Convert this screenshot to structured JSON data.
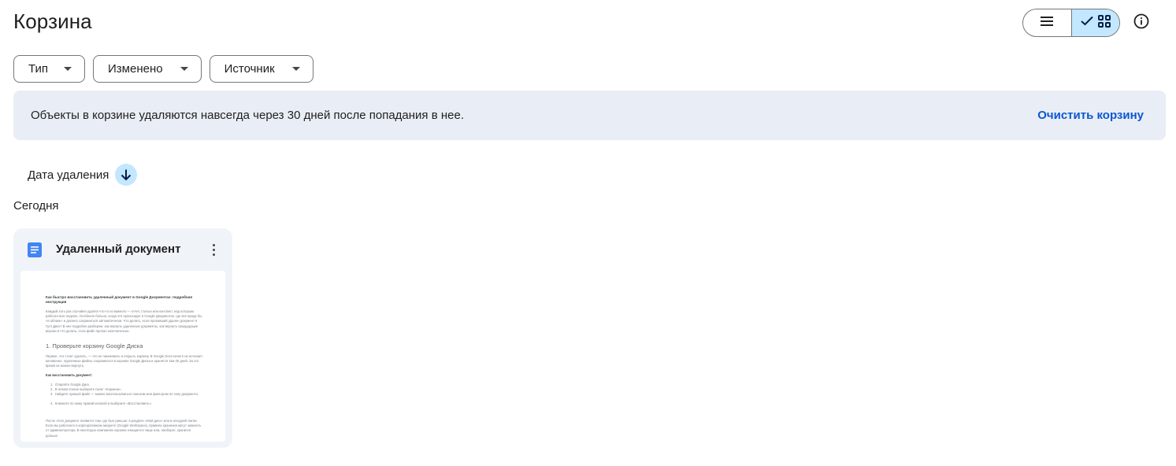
{
  "header": {
    "title": "Корзина",
    "view_toggle": {
      "list_icon": "list-icon",
      "grid_icon": "grid-icon",
      "check_icon": "check-icon",
      "active": "grid"
    },
    "info_icon": "info-icon"
  },
  "filters": [
    {
      "label": "Тип"
    },
    {
      "label": "Изменено"
    },
    {
      "label": "Источник"
    }
  ],
  "banner": {
    "text": "Объекты в корзине удаляются навсегда через 30 дней после попадания в нее.",
    "action": "Очистить корзину"
  },
  "sort": {
    "label": "Дата удаления",
    "direction_icon": "arrow-down-icon"
  },
  "group": {
    "label": "Сегодня"
  },
  "files": [
    {
      "name": "Удаленный документ",
      "type_icon": "google-docs-icon",
      "preview": {
        "title": "Как быстро восстановить удаленный документ в Google Документах: подробная инструкция",
        "intro": "Каждый хоть раз случайно удалял что-то из важного — отчет, статью или конспект, над которым работал всю неделю. Особенно больно, когда это происходит в Google Документах, где все вроде бы «в облаке» и должно сохраниться автоматически. Что делать, если пропавший удален документ в Гугл Диск? В нее подробно разберем, как вернуть удаленные документы, как вернуть предыдущие версии и что делать, если файл пропал окончательно.",
        "heading": "1. Проверьте корзину Google Диска",
        "para2": "Первое, что стоит сделать, — это не паниковать и открыть корзину. В Google Docs ничего не исчезает мгновенно. Удаленные файлы сохраняются в корзине Google Диска и хранятся там 30 дней. За это время их можно вернуть.",
        "subheading": "Как восстановить документ:",
        "steps": [
          "Откройте Google Диск.",
          "В левом списке выберите пункт «Корзина».",
          "Найдите нужный файл — можно воспользоваться поиском или фильтром по типу документа.",
          "Кликните по нему правой кнопкой и выберите «Восстановить»."
        ],
        "para3": "После этого документ появится там, где был раньше: в разделе «Мой диск» или в исходной папке. Если вы работаете в корпоративном аккаунте (Google Workspace), правила хранения могут зависеть от администратора. В некоторых компаниях корзина очищается чаще или, наоборот, хранится дольше."
      }
    }
  ],
  "colors": {
    "accent": "#0b57d0",
    "banner_bg": "#e9eef6",
    "selected_bg": "#c2e7ff",
    "card_bg": "#f0f4f9",
    "docs_blue": "#4285f4"
  }
}
